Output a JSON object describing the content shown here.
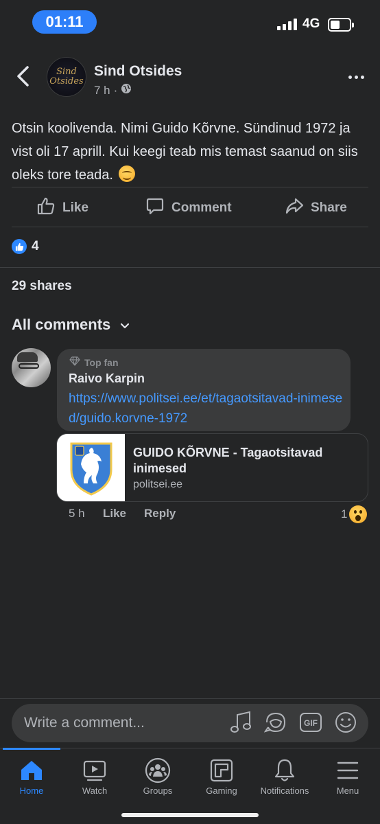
{
  "status_bar": {
    "time": "01:11",
    "network": "4G"
  },
  "post": {
    "page_name": "Sind Otsides",
    "avatar_text_line1": "Sind",
    "avatar_text_line2": "Otsides",
    "time": "7 h",
    "separator": "·",
    "text": "Otsin koolivenda. Nimi Guido Kõrvne. Sündinud 1972 ja vist oli 17 aprill. Kui keegi teab mis temast saanud on siis oleks tore teada."
  },
  "actions": {
    "like": "Like",
    "comment": "Comment",
    "share": "Share"
  },
  "reactions": {
    "count": "4"
  },
  "shares": "29 shares",
  "comments_filter": "All comments",
  "comment": {
    "badge": "Top fan",
    "author": "Raivo Karpin",
    "link": "https://www.politsei.ee/et/tagaotsitavad-inimesed/guido.korvne-1972",
    "preview_title": "GUIDO KÕRVNE - Tagaotsitavad inimesed",
    "preview_domain": "politsei.ee",
    "time": "5 h",
    "like": "Like",
    "reply": "Reply",
    "reaction_count": "1"
  },
  "composer": {
    "placeholder": "Write a comment..."
  },
  "nav": {
    "home": "Home",
    "watch": "Watch",
    "groups": "Groups",
    "gaming": "Gaming",
    "notifications": "Notifications",
    "menu": "Menu"
  },
  "colors": {
    "accent": "#2d88ff",
    "link": "#4599ff",
    "background": "#242526",
    "bubble": "#3a3b3c"
  }
}
